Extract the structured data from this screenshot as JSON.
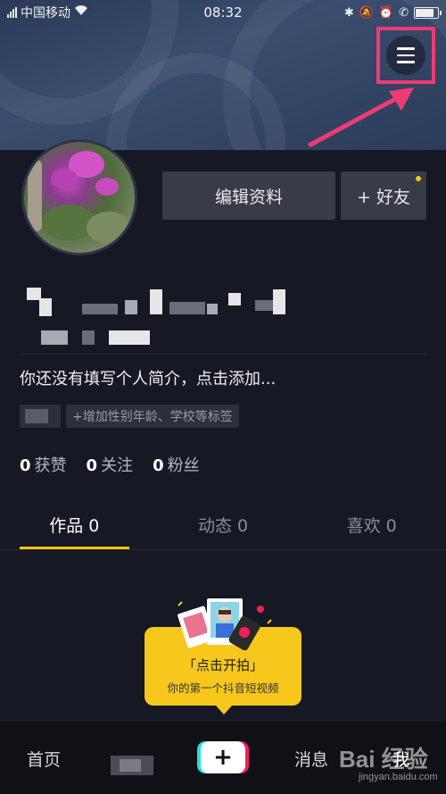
{
  "status_bar": {
    "carrier": "中国移动",
    "time": "08:32"
  },
  "header": {
    "menu_icon": "hamburger-menu-icon"
  },
  "profile": {
    "edit_label": "编辑资料",
    "add_friend_label": "+ 好友",
    "bio": "你还没有填写个人简介，点击添加...",
    "add_tags_label": "+增加性别年龄、学校等标签"
  },
  "stats": {
    "likes": {
      "count": "0",
      "label": "获赞"
    },
    "following": {
      "count": "0",
      "label": "关注"
    },
    "followers": {
      "count": "0",
      "label": "粉丝"
    }
  },
  "tabs": [
    {
      "label": "作品 0",
      "active": true
    },
    {
      "label": "动态 0",
      "active": false
    },
    {
      "label": "喜欢 0",
      "active": false
    }
  ],
  "shoot_prompt": {
    "title": "「点击开拍」",
    "subtitle": "你的第一个抖音短视频"
  },
  "bottom_nav": {
    "home": "首页",
    "create": "+",
    "messages": "消息",
    "me": "我"
  },
  "watermark": {
    "text": "Bai 经验",
    "sub": "jingyan.baidu.com"
  },
  "colors": {
    "accent": "#f5c518",
    "highlight": "#ef3b73",
    "background": "#161823"
  }
}
